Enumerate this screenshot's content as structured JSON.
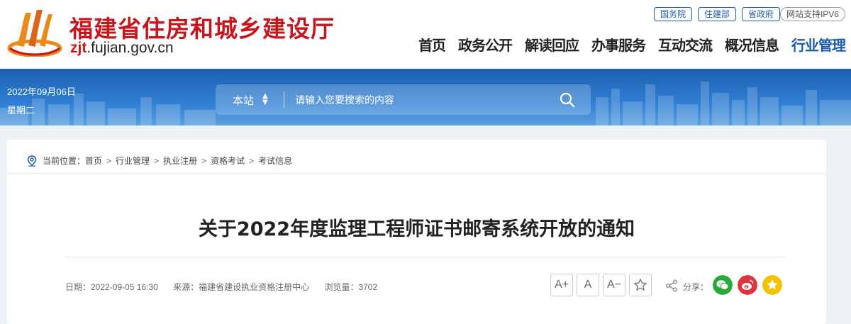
{
  "header": {
    "title": "福建省住房和城乡建设厅",
    "domain_prefix": "zjt",
    "domain_rest": ".fujian.gov.cn",
    "top_links": [
      "国务院",
      "住建部",
      "省政府"
    ],
    "ipv6": "网站支持IPV6",
    "nav": [
      "首页",
      "政务公开",
      "解读回应",
      "办事服务",
      "互动交流",
      "概况信息",
      "行业管理"
    ],
    "active_nav": "行业管理"
  },
  "banner": {
    "date": "2022年09月06日",
    "weekday": "星期二",
    "search_scope": "本站",
    "search_placeholder": "请输入您要搜索的内容"
  },
  "breadcrumb": {
    "prefix": "当前位置：",
    "items": [
      "首页",
      "行业管理",
      "执业注册",
      "资格考试",
      "考试信息"
    ]
  },
  "article": {
    "title": "关于2022年度监理工程师证书邮寄系统开放的通知",
    "date": "日期：2022-09-05 16:30",
    "source": "来源：福建省建设执业资格注册中心",
    "views": "浏览量：3702"
  },
  "toolbar": {
    "font_larger": "A+",
    "font_normal": "A",
    "font_smaller": "A−",
    "share_label": "分享："
  },
  "colors": {
    "brand_red": "#c8161d",
    "nav_blue": "#1e5aa8",
    "wechat": "#2aa83a",
    "weibo": "#e0343c",
    "qzone": "#f2c200"
  }
}
